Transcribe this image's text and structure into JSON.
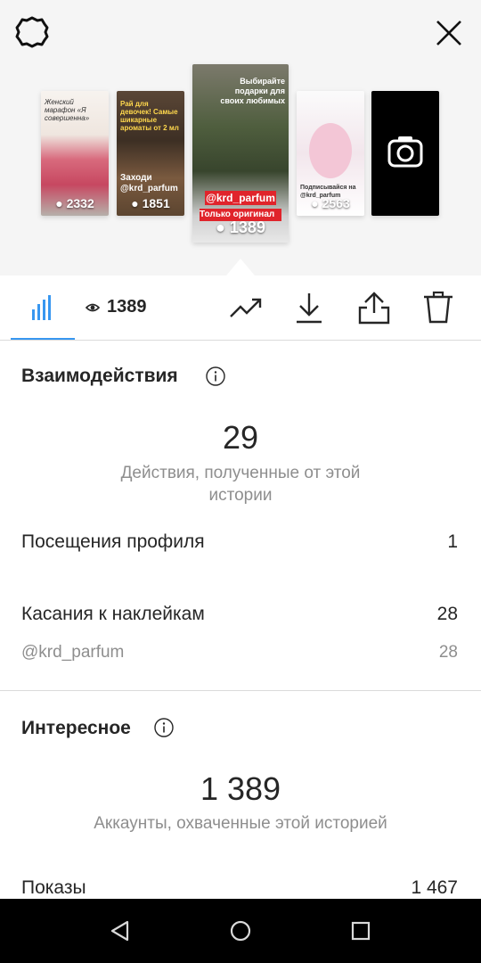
{
  "header": {
    "settings_icon": "gear-icon",
    "close_icon": "close-icon"
  },
  "stories": [
    {
      "views": "2332",
      "caption": "Женский марафон «Я совершенна»"
    },
    {
      "views": "1851",
      "caption": "Рай для девочек! Самые шикарные ароматы от 2 мл",
      "handle": "Заходи @krd_parfum"
    },
    {
      "views": "1389",
      "caption": "Выбирайте подарки для своих любимых",
      "handle": "@krd_parfum",
      "note": "Только оригинал"
    },
    {
      "views": "2563",
      "caption": "Подписывайся на @krd_parfum"
    },
    {
      "camera_icon": "camera-icon"
    }
  ],
  "toolbar": {
    "views_label": "1389",
    "icons": [
      "bar-chart-icon",
      "eye-icon",
      "trend-icon",
      "download-icon",
      "share-icon",
      "trash-icon"
    ]
  },
  "interactions": {
    "title": "Взаимодействия",
    "total": "29",
    "description": "Действия, полученные от этой истории",
    "rows": [
      {
        "label": "Посещения профиля",
        "value": "1"
      },
      {
        "label": "Касания к наклейкам",
        "value": "28"
      }
    ],
    "sub_rows": [
      {
        "label": "@krd_parfum",
        "value": "28"
      }
    ]
  },
  "discovery": {
    "title": "Интересное",
    "total": "1 389",
    "description": "Аккаунты, охваченные этой историей",
    "rows": [
      {
        "label": "Показы",
        "value": "1 467"
      }
    ]
  },
  "colors": {
    "accent": "#3897f0",
    "text": "#262626",
    "muted": "#8e8e8e",
    "handle_red": "#e0242b"
  }
}
